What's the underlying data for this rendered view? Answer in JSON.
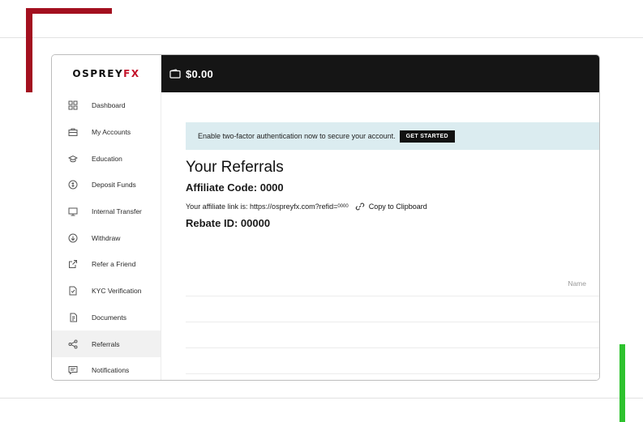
{
  "brand": {
    "logo_main": "OSPREY",
    "logo_accent": "FX"
  },
  "topbar": {
    "balance": "$0.00"
  },
  "sidebar": {
    "items": [
      {
        "label": "Dashboard",
        "icon": "grid-icon"
      },
      {
        "label": "My Accounts",
        "icon": "briefcase-icon"
      },
      {
        "label": "Education",
        "icon": "graduation-cap-icon"
      },
      {
        "label": "Deposit Funds",
        "icon": "coin-icon"
      },
      {
        "label": "Internal Transfer",
        "icon": "transfer-icon"
      },
      {
        "label": "Withdraw",
        "icon": "withdraw-icon"
      },
      {
        "label": "Refer a Friend",
        "icon": "share-icon"
      },
      {
        "label": "KYC Verification",
        "icon": "document-check-icon"
      },
      {
        "label": "Documents",
        "icon": "documents-icon"
      },
      {
        "label": "Referrals",
        "icon": "network-icon",
        "active": true
      },
      {
        "label": "Notifications",
        "icon": "message-icon"
      }
    ]
  },
  "banner": {
    "text": "Enable two-factor authentication now to secure your account.",
    "button": "GET STARTED"
  },
  "referrals": {
    "title": "Your Referrals",
    "affiliate_code": "Affiliate Code: 0000",
    "link_prefix": "Your affiliate link is: https://ospreyfx.com?refid=",
    "link_code": "0000",
    "copy_label": "Copy to Clipboard",
    "rebate_id": "Rebate ID: 00000"
  },
  "table": {
    "columns": [
      "Name"
    ],
    "rows": []
  },
  "colors": {
    "accent": "#c4142b",
    "topbar": "#151515",
    "banner": "#dbecf0"
  }
}
